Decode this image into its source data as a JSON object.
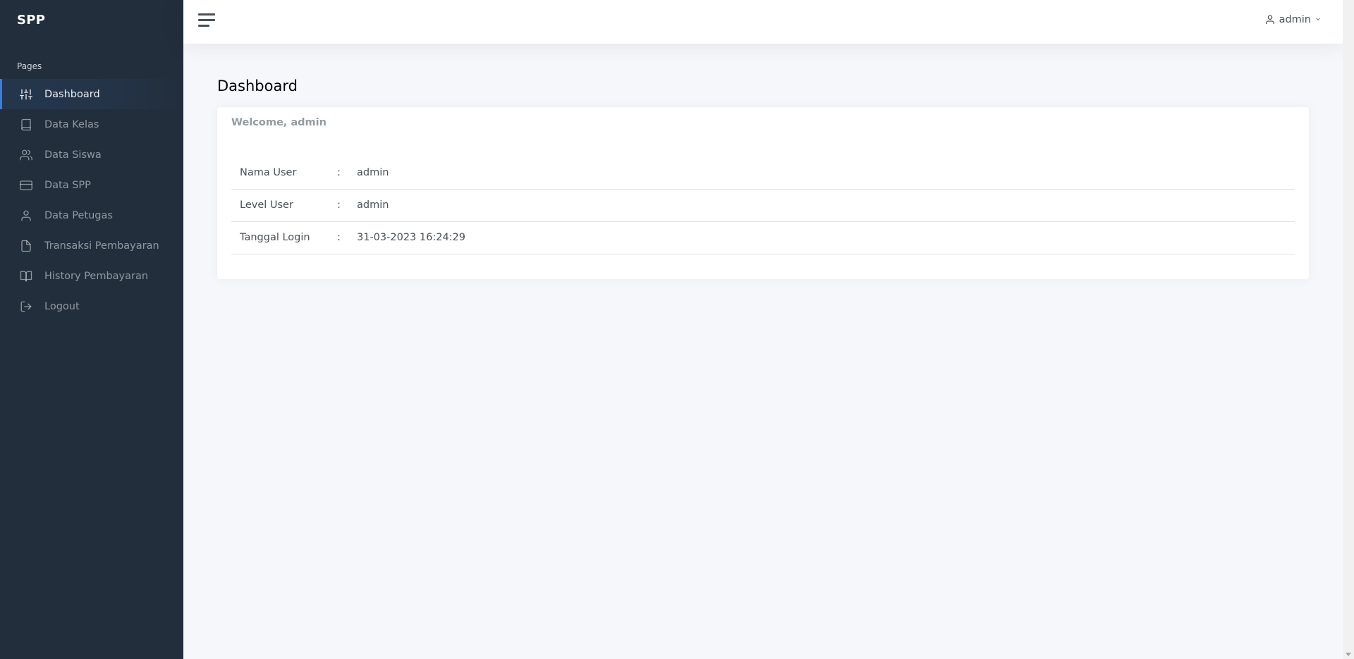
{
  "brand": "SPP",
  "sidebar": {
    "section_header": "Pages",
    "items": [
      {
        "label": "Dashboard",
        "icon": "sliders-icon",
        "active": true
      },
      {
        "label": "Data Kelas",
        "icon": "book-icon"
      },
      {
        "label": "Data Siswa",
        "icon": "users-icon"
      },
      {
        "label": "Data SPP",
        "icon": "credit-card-icon"
      },
      {
        "label": "Data Petugas",
        "icon": "user-icon"
      },
      {
        "label": "Transaksi Pembayaran",
        "icon": "file-icon"
      },
      {
        "label": "History Pembayaran",
        "icon": "book-open-icon"
      },
      {
        "label": "Logout",
        "icon": "log-out-icon"
      }
    ]
  },
  "topbar": {
    "user_label": "admin"
  },
  "main": {
    "title": "Dashboard",
    "card": {
      "title": "Welcome, admin",
      "rows": [
        {
          "label": "Nama User",
          "sep": ":",
          "value": "admin"
        },
        {
          "label": "Level User",
          "sep": ":",
          "value": "admin"
        },
        {
          "label": "Tanggal Login",
          "sep": ":",
          "value": "31-03-2023 16:24:29"
        }
      ]
    }
  },
  "colors": {
    "sidebar_bg": "#222e3c",
    "accent": "#3b7ddd",
    "page_bg": "#f5f7fb"
  }
}
